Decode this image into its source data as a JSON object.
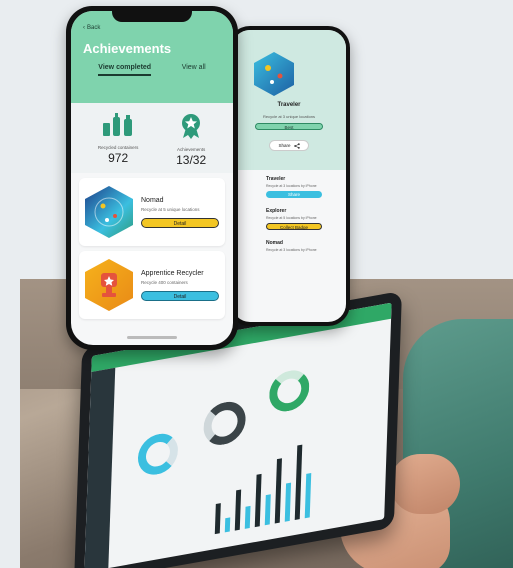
{
  "front_phone": {
    "back_label": "Back",
    "title": "Achievements",
    "tabs": [
      {
        "label": "View completed",
        "active": true
      },
      {
        "label": "View all",
        "active": false
      }
    ],
    "stats": [
      {
        "label": "Recycled containers",
        "value": "972",
        "icon": "bottles-icon"
      },
      {
        "label": "Achievements",
        "value": "13/32",
        "icon": "award-ribbon-icon"
      }
    ],
    "cards": [
      {
        "name": "Nomad",
        "desc": "Recycle at 5 unique locations",
        "button": "Detail",
        "button_color": "#f3c623",
        "badge": "globe-hex-badge"
      },
      {
        "name": "Apprentice Recycler",
        "desc": "Recycle 400 containers",
        "button": "Detail",
        "button_color": "#3bbfe0",
        "badge": "trophy-hex-badge"
      }
    ]
  },
  "back_phone": {
    "hero_title": "Traveler",
    "hero_desc": "Recycle at 3 unique locations",
    "hero_button": "Best",
    "share_label": "Share",
    "list": [
      {
        "name": "Traveler",
        "desc": "Recycle at 3 locations by iPhone",
        "button": "Share",
        "button_color": "#3bbfe0"
      },
      {
        "name": "Explorer",
        "desc": "Recycle at 5 locations by iPhone",
        "button": "Collect Badge",
        "button_color": "#f3c623"
      },
      {
        "name": "Nomad",
        "desc": "Recycle at 3 locations by iPhone",
        "button": "",
        "button_color": ""
      }
    ]
  },
  "colors": {
    "accent_green": "#7fd3ad",
    "teal": "#3bbfe0",
    "yellow": "#f3c623",
    "tablet_green": "#2fa866"
  }
}
